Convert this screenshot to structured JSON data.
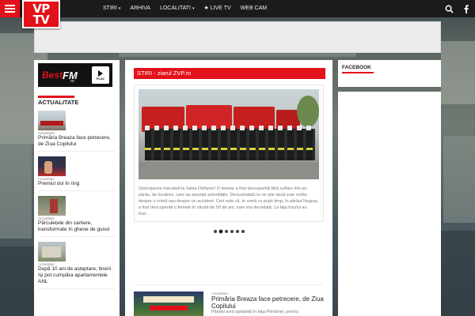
{
  "logo": {
    "line1": "VP",
    "line2": "TV"
  },
  "nav": {
    "items": [
      {
        "label": "STIRI",
        "has_caret": true
      },
      {
        "label": "ARHIVA",
        "has_caret": false
      },
      {
        "label": "LOCALITATI",
        "has_caret": true
      },
      {
        "label": "★ LIVE TV",
        "has_caret": false
      },
      {
        "label": "WEB CAM",
        "has_caret": false
      }
    ],
    "caret": "▾",
    "search_icon": "search-icon",
    "facebook_icon": "facebook-icon"
  },
  "bestfm": {
    "brand": "Best",
    "fm": "FM",
    "tld": ".ro",
    "play": "PLAY"
  },
  "left": {
    "section_title": "ACTUALITATE",
    "items": [
      {
        "category": "Actualitate",
        "title": "Primăria Breaza face petrecere, de Ziua Copilului"
      },
      {
        "category": "Actualitate",
        "title": "Premiul doi în ring"
      },
      {
        "category": "Actualitate",
        "title": "Părculețele din cartiere, transformate în ghene de gunoi"
      },
      {
        "category": "Actualitate",
        "title": "După 10 ani de așteptare, tinerii își pot cumpăra apartamentele ANL"
      }
    ]
  },
  "center": {
    "section_title": "STIRI - ziarul ZVP.ro",
    "excerpt": "Descoperire macabră la Valea Doftanei! O femeie a fost descoperită fără suflare într-un pârâu, de localnici, care au anunțat autoritățile. Deocamdată nu se știe dacă este vorba despre o crimă sau despre un accident. Cert este că, în urmă cu puțin timp, în pârâul Negraș, a fost descoperită o femeie în vârstă de 50 de ani, care era decedată. La fața locului au fost…",
    "dots": 6,
    "active_dot": 1,
    "article": {
      "category": "Actualitate",
      "title": "Primăria Breaza face petrecere, de Ziua Copilului",
      "snippet": "Părinții sunt așteptați în fața Primăriei, pentru"
    }
  },
  "right": {
    "section_title": "FACEBOOK"
  },
  "colors": {
    "accent": "#e3111a",
    "topbar": "#1b1b1b"
  }
}
